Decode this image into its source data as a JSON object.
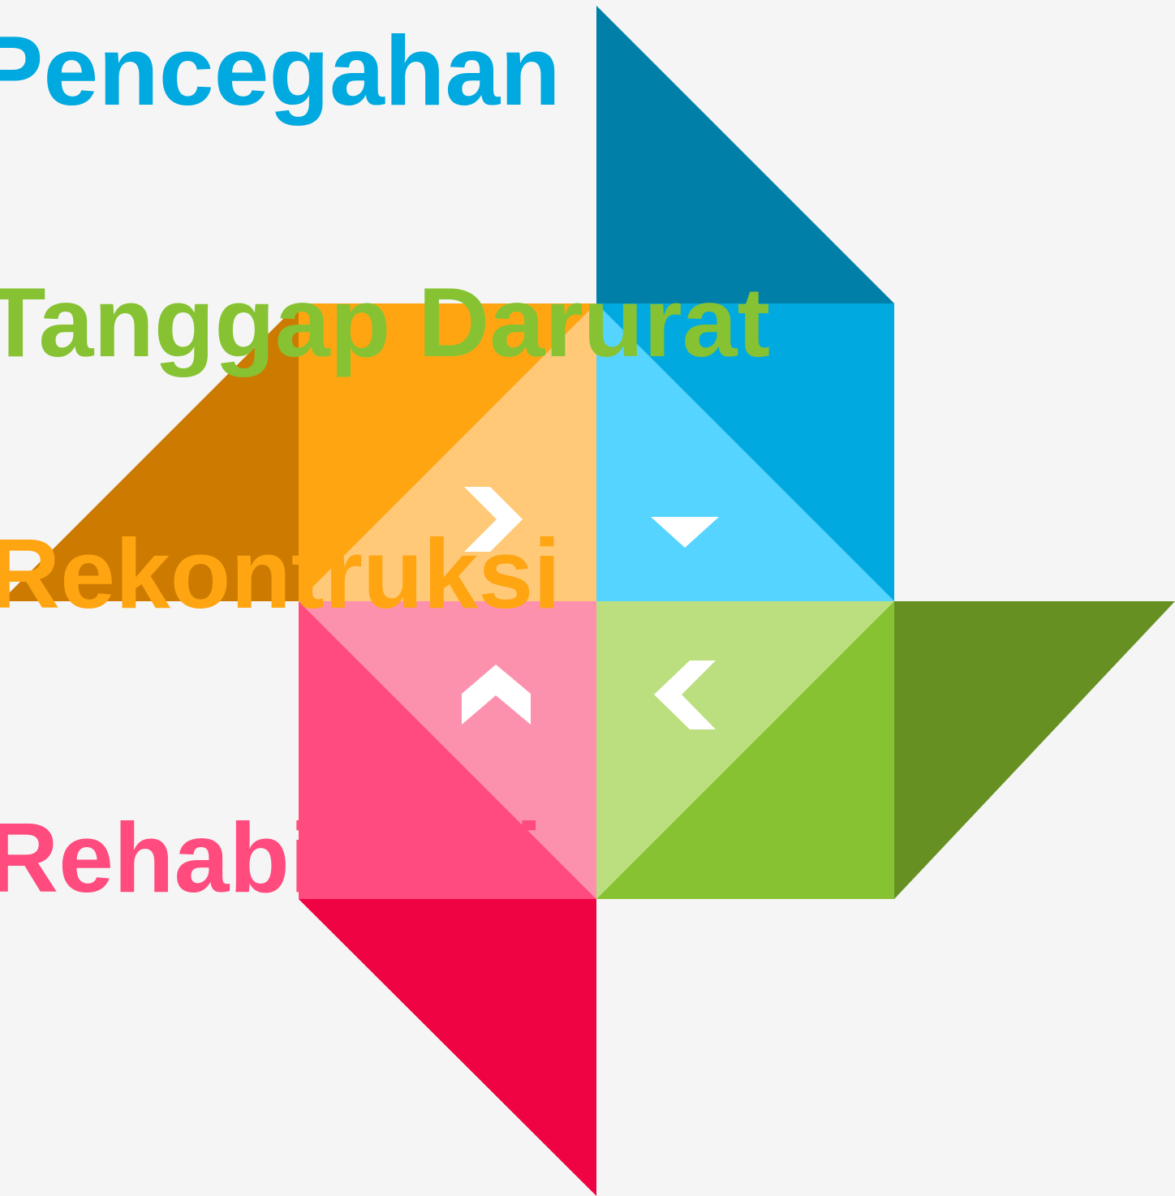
{
  "background": "#F5F5F5",
  "labels": [
    {
      "key": "pencegahan",
      "text": "Pencegahan",
      "color": "#00A9DF"
    },
    {
      "key": "tanggap_darurat",
      "text": "Tanggap Darurat",
      "color": "#86C232"
    },
    {
      "key": "rekonstruksi",
      "text": "Rekontruksi",
      "color": "#FFA512"
    },
    {
      "key": "rehabilitasi",
      "text": "Rehabilitasi",
      "color": "#FF4B7E"
    }
  ],
  "colors": {
    "blue_dark": "#0080A8",
    "blue": "#00A9DF",
    "blue_light": "#55D4FF",
    "orange_dark": "#CC7B00",
    "orange": "#FFA512",
    "orange_light": "#FFC978",
    "pink": "#FF4B7E",
    "pink_light": "#FC91AE",
    "red": "#EF0342",
    "green_dark": "#669122",
    "green": "#86C232",
    "green_light": "#BBDF7E",
    "arrow": "#FFFFFF"
  },
  "arrows": [
    {
      "name": "chevron-right-icon",
      "direction": "right"
    },
    {
      "name": "caret-down-icon",
      "direction": "down"
    },
    {
      "name": "chevron-up-icon",
      "direction": "up"
    },
    {
      "name": "chevron-left-icon",
      "direction": "left"
    }
  ]
}
